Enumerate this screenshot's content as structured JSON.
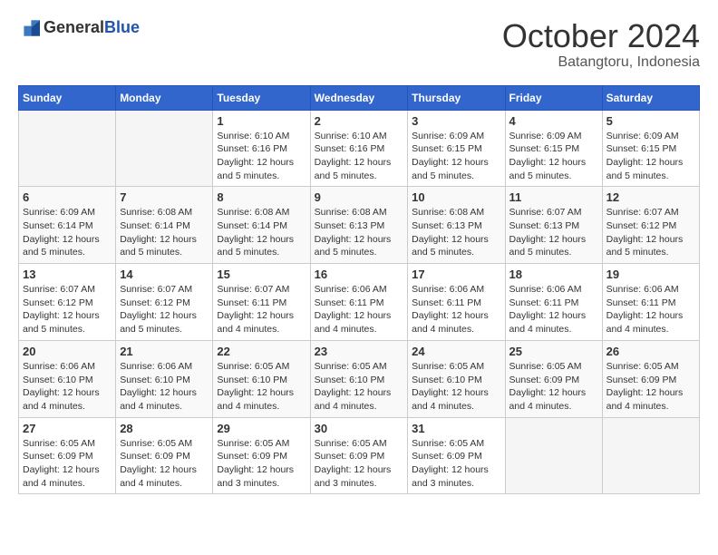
{
  "logo": {
    "general": "General",
    "blue": "Blue"
  },
  "title": "October 2024",
  "location": "Batangtoru, Indonesia",
  "days_header": [
    "Sunday",
    "Monday",
    "Tuesday",
    "Wednesday",
    "Thursday",
    "Friday",
    "Saturday"
  ],
  "weeks": [
    [
      {
        "day": "",
        "info": ""
      },
      {
        "day": "",
        "info": ""
      },
      {
        "day": "1",
        "info": "Sunrise: 6:10 AM\nSunset: 6:16 PM\nDaylight: 12 hours and 5 minutes."
      },
      {
        "day": "2",
        "info": "Sunrise: 6:10 AM\nSunset: 6:16 PM\nDaylight: 12 hours and 5 minutes."
      },
      {
        "day": "3",
        "info": "Sunrise: 6:09 AM\nSunset: 6:15 PM\nDaylight: 12 hours and 5 minutes."
      },
      {
        "day": "4",
        "info": "Sunrise: 6:09 AM\nSunset: 6:15 PM\nDaylight: 12 hours and 5 minutes."
      },
      {
        "day": "5",
        "info": "Sunrise: 6:09 AM\nSunset: 6:15 PM\nDaylight: 12 hours and 5 minutes."
      }
    ],
    [
      {
        "day": "6",
        "info": "Sunrise: 6:09 AM\nSunset: 6:14 PM\nDaylight: 12 hours and 5 minutes."
      },
      {
        "day": "7",
        "info": "Sunrise: 6:08 AM\nSunset: 6:14 PM\nDaylight: 12 hours and 5 minutes."
      },
      {
        "day": "8",
        "info": "Sunrise: 6:08 AM\nSunset: 6:14 PM\nDaylight: 12 hours and 5 minutes."
      },
      {
        "day": "9",
        "info": "Sunrise: 6:08 AM\nSunset: 6:13 PM\nDaylight: 12 hours and 5 minutes."
      },
      {
        "day": "10",
        "info": "Sunrise: 6:08 AM\nSunset: 6:13 PM\nDaylight: 12 hours and 5 minutes."
      },
      {
        "day": "11",
        "info": "Sunrise: 6:07 AM\nSunset: 6:13 PM\nDaylight: 12 hours and 5 minutes."
      },
      {
        "day": "12",
        "info": "Sunrise: 6:07 AM\nSunset: 6:12 PM\nDaylight: 12 hours and 5 minutes."
      }
    ],
    [
      {
        "day": "13",
        "info": "Sunrise: 6:07 AM\nSunset: 6:12 PM\nDaylight: 12 hours and 5 minutes."
      },
      {
        "day": "14",
        "info": "Sunrise: 6:07 AM\nSunset: 6:12 PM\nDaylight: 12 hours and 5 minutes."
      },
      {
        "day": "15",
        "info": "Sunrise: 6:07 AM\nSunset: 6:11 PM\nDaylight: 12 hours and 4 minutes."
      },
      {
        "day": "16",
        "info": "Sunrise: 6:06 AM\nSunset: 6:11 PM\nDaylight: 12 hours and 4 minutes."
      },
      {
        "day": "17",
        "info": "Sunrise: 6:06 AM\nSunset: 6:11 PM\nDaylight: 12 hours and 4 minutes."
      },
      {
        "day": "18",
        "info": "Sunrise: 6:06 AM\nSunset: 6:11 PM\nDaylight: 12 hours and 4 minutes."
      },
      {
        "day": "19",
        "info": "Sunrise: 6:06 AM\nSunset: 6:11 PM\nDaylight: 12 hours and 4 minutes."
      }
    ],
    [
      {
        "day": "20",
        "info": "Sunrise: 6:06 AM\nSunset: 6:10 PM\nDaylight: 12 hours and 4 minutes."
      },
      {
        "day": "21",
        "info": "Sunrise: 6:06 AM\nSunset: 6:10 PM\nDaylight: 12 hours and 4 minutes."
      },
      {
        "day": "22",
        "info": "Sunrise: 6:05 AM\nSunset: 6:10 PM\nDaylight: 12 hours and 4 minutes."
      },
      {
        "day": "23",
        "info": "Sunrise: 6:05 AM\nSunset: 6:10 PM\nDaylight: 12 hours and 4 minutes."
      },
      {
        "day": "24",
        "info": "Sunrise: 6:05 AM\nSunset: 6:10 PM\nDaylight: 12 hours and 4 minutes."
      },
      {
        "day": "25",
        "info": "Sunrise: 6:05 AM\nSunset: 6:09 PM\nDaylight: 12 hours and 4 minutes."
      },
      {
        "day": "26",
        "info": "Sunrise: 6:05 AM\nSunset: 6:09 PM\nDaylight: 12 hours and 4 minutes."
      }
    ],
    [
      {
        "day": "27",
        "info": "Sunrise: 6:05 AM\nSunset: 6:09 PM\nDaylight: 12 hours and 4 minutes."
      },
      {
        "day": "28",
        "info": "Sunrise: 6:05 AM\nSunset: 6:09 PM\nDaylight: 12 hours and 4 minutes."
      },
      {
        "day": "29",
        "info": "Sunrise: 6:05 AM\nSunset: 6:09 PM\nDaylight: 12 hours and 3 minutes."
      },
      {
        "day": "30",
        "info": "Sunrise: 6:05 AM\nSunset: 6:09 PM\nDaylight: 12 hours and 3 minutes."
      },
      {
        "day": "31",
        "info": "Sunrise: 6:05 AM\nSunset: 6:09 PM\nDaylight: 12 hours and 3 minutes."
      },
      {
        "day": "",
        "info": ""
      },
      {
        "day": "",
        "info": ""
      }
    ]
  ]
}
